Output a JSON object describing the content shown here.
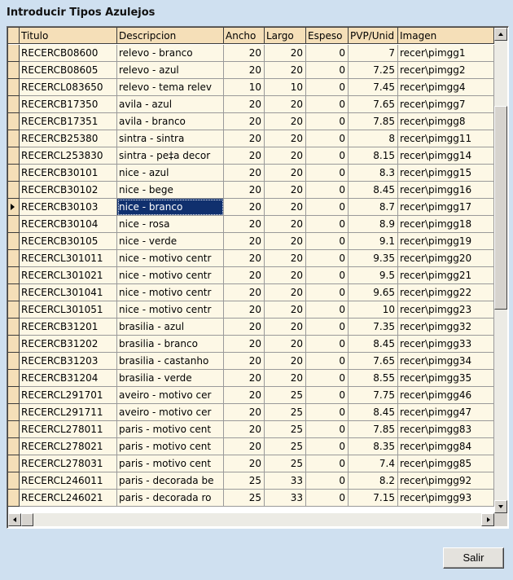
{
  "window": {
    "title": "Introducir Tipos Azulejos"
  },
  "grid": {
    "columns": [
      "Titulo",
      "Descripcion",
      "Ancho",
      "Largo",
      "Espeso",
      "PVP/Unid",
      "Imagen"
    ],
    "selected_row": 9,
    "rows": [
      [
        "RECERCB08600",
        "relevo - branco",
        "20",
        "20",
        "0",
        "7",
        "recer\\pimgg1"
      ],
      [
        "RECERCB08605",
        "relevo - azul",
        "20",
        "20",
        "0",
        "7.25",
        "recer\\pimgg2"
      ],
      [
        "RECERCL083650",
        "relevo - tema relev",
        "10",
        "10",
        "0",
        "7.45",
        "recer\\pimgg4"
      ],
      [
        "RECERCB17350",
        "avila - azul",
        "20",
        "20",
        "0",
        "7.65",
        "recer\\pimgg7"
      ],
      [
        "RECERCB17351",
        "avila - branco",
        "20",
        "20",
        "0",
        "7.85",
        "recer\\pimgg8"
      ],
      [
        "RECERCB25380",
        "sintra - sintra",
        "20",
        "20",
        "0",
        "8",
        "recer\\pimgg11"
      ],
      [
        "RECERCL253830",
        "sintra - pe‡a decor",
        "20",
        "20",
        "0",
        "8.15",
        "recer\\pimgg14"
      ],
      [
        "RECERCB30101",
        "nice - azul",
        "20",
        "20",
        "0",
        "8.3",
        "recer\\pimgg15"
      ],
      [
        "RECERCB30102",
        "nice - bege",
        "20",
        "20",
        "0",
        "8.45",
        "recer\\pimgg16"
      ],
      [
        "RECERCB30103",
        "nice - branco",
        "20",
        "20",
        "0",
        "8.7",
        "recer\\pimgg17"
      ],
      [
        "RECERCB30104",
        "nice - rosa",
        "20",
        "20",
        "0",
        "8.9",
        "recer\\pimgg18"
      ],
      [
        "RECERCB30105",
        "nice - verde",
        "20",
        "20",
        "0",
        "9.1",
        "recer\\pimgg19"
      ],
      [
        "RECERCL301011",
        "nice - motivo centr",
        "20",
        "20",
        "0",
        "9.35",
        "recer\\pimgg20"
      ],
      [
        "RECERCL301021",
        "nice - motivo centr",
        "20",
        "20",
        "0",
        "9.5",
        "recer\\pimgg21"
      ],
      [
        "RECERCL301041",
        "nice - motivo centr",
        "20",
        "20",
        "0",
        "9.65",
        "recer\\pimgg22"
      ],
      [
        "RECERCL301051",
        "nice - motivo centr",
        "20",
        "20",
        "0",
        "10",
        "recer\\pimgg23"
      ],
      [
        "RECERCB31201",
        "brasilia - azul",
        "20",
        "20",
        "0",
        "7.35",
        "recer\\pimgg32"
      ],
      [
        "RECERCB31202",
        "brasilia - branco",
        "20",
        "20",
        "0",
        "8.45",
        "recer\\pimgg33"
      ],
      [
        "RECERCB31203",
        "brasilia - castanho",
        "20",
        "20",
        "0",
        "7.65",
        "recer\\pimgg34"
      ],
      [
        "RECERCB31204",
        "brasilia - verde",
        "20",
        "20",
        "0",
        "8.55",
        "recer\\pimgg35"
      ],
      [
        "RECERCL291701",
        "aveiro - motivo cer",
        "20",
        "25",
        "0",
        "7.75",
        "recer\\pimgg46"
      ],
      [
        "RECERCL291711",
        "aveiro - motivo cer",
        "20",
        "25",
        "0",
        "8.45",
        "recer\\pimgg47"
      ],
      [
        "RECERCL278011",
        "paris - motivo cent",
        "20",
        "25",
        "0",
        "7.85",
        "recer\\pimgg83"
      ],
      [
        "RECERCL278021",
        "paris - motivo cent",
        "20",
        "25",
        "0",
        "8.35",
        "recer\\pimgg84"
      ],
      [
        "RECERCL278031",
        "paris - motivo cent",
        "20",
        "25",
        "0",
        "7.4",
        "recer\\pimgg85"
      ],
      [
        "RECERCL246011",
        "paris - decorada be",
        "25",
        "33",
        "0",
        "8.2",
        "recer\\pimgg92"
      ],
      [
        "RECERCL246021",
        "paris - decorada ro",
        "25",
        "33",
        "0",
        "7.15",
        "recer\\pimgg93"
      ]
    ]
  },
  "buttons": {
    "salir": "Salir"
  },
  "colors": {
    "background": "#cfe0f0",
    "header": "#f5dfb8",
    "cell": "#fdf8e6",
    "selection": "#10306e"
  },
  "icons": {
    "row_indicator": "triangle-right-icon",
    "scroll_up": "arrow-up-icon",
    "scroll_down": "arrow-down-icon",
    "scroll_left": "arrow-left-icon",
    "scroll_right": "arrow-right-icon"
  }
}
